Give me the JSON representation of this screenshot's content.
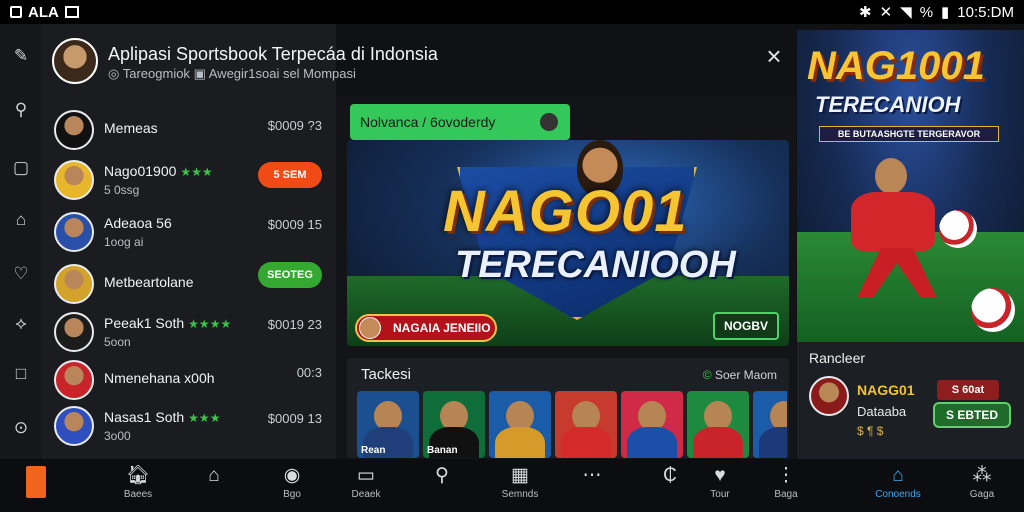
{
  "status_bar": {
    "left_text": "ALA",
    "right_percent": "%",
    "time": "10:5:DM"
  },
  "header": {
    "title": "Aplipasi Sportsbook Terpecáa di Indonsia",
    "subtitle_a": "Tareogmiok",
    "subtitle_b": "Awegir1soai sel Mompasi",
    "close_glyph": "×"
  },
  "chats": [
    {
      "name": "Memeas",
      "sub": "",
      "stars": "",
      "amount": "$0009 ?3",
      "pill": ""
    },
    {
      "name": "Nago01900",
      "sub": "5 0ssg",
      "stars": "★★★",
      "amount": "",
      "pill": "5 SEM",
      "pill_color": "orange"
    },
    {
      "name": "Adeaoa 56",
      "sub": "1oog ai",
      "stars": "",
      "amount": "$0009 15",
      "pill": ""
    },
    {
      "name": "Metbeartolane",
      "sub": "",
      "stars": "",
      "amount": "",
      "pill": "SEOTEG",
      "pill_color": "green"
    },
    {
      "name": "Peeak1 Soth",
      "sub": "5oon",
      "stars": "★★★★",
      "amount": "$0019 23",
      "pill": ""
    },
    {
      "name": "Nmenehana x00h",
      "sub": "",
      "stars": "",
      "amount": "00:3",
      "pill": ""
    },
    {
      "name": "Nasas1 Soth",
      "sub": "3o00",
      "stars": "★★★",
      "amount": "$0009 13",
      "pill": ""
    }
  ],
  "promo": {
    "label": "Nolvanca / 6ovoderdy"
  },
  "banner": {
    "headline": "NAGO01",
    "tagline": "TERECANIOOH",
    "left_button": "NAGAIA JENEIIO",
    "right_button": "NOGBV"
  },
  "tackle": {
    "title": "Tackesi",
    "link_icon": "©",
    "link_text": "Soer Maom",
    "tiles": [
      {
        "label": "Rean",
        "bg": "#1b4f8f",
        "shirt": "#1f3e7a"
      },
      {
        "label": "Banan",
        "bg": "#0f6d3a",
        "shirt": "#111"
      },
      {
        "label": "",
        "bg": "#1b5ca8",
        "shirt": "#d59a2a"
      },
      {
        "label": "",
        "bg": "#c73a2e",
        "shirt": "#d52a2a"
      },
      {
        "label": "",
        "bg": "#d12a46",
        "shirt": "#1c50a8"
      },
      {
        "label": "",
        "bg": "#1e8a40",
        "shirt": "#c8242a"
      },
      {
        "label": "",
        "bg": "#1b5ca8",
        "shirt": "#1c3a7a"
      }
    ]
  },
  "poster": {
    "title": "NAG1001",
    "subtitle": "TERECANIOH",
    "strip": "BE BUTAASHGTE TERGERAVOR"
  },
  "right_card": {
    "header": "Rancleer",
    "name": "NAGG01",
    "sub": "Dataaba",
    "stars": "$ ¶ $",
    "pill_top": "S 60at",
    "pill_bottom": "S EBTED"
  },
  "bottom_nav": [
    {
      "label": "Baees",
      "icon": "🏠︎"
    },
    {
      "label": "",
      "icon": "⌂"
    },
    {
      "label": "Bgo",
      "icon": "◉"
    },
    {
      "label": "Deaek",
      "icon": "▭"
    },
    {
      "label": "",
      "icon": "⚲"
    },
    {
      "label": "Semnds",
      "icon": "▦"
    },
    {
      "label": "",
      "icon": "⋯"
    },
    {
      "label": "",
      "icon": "₵"
    },
    {
      "label": "Tour",
      "icon": "♥"
    },
    {
      "label": "Baga",
      "icon": "⋮"
    },
    {
      "label": "Conoends",
      "icon": "⌂"
    },
    {
      "label": "Gaga",
      "icon": "⁂"
    }
  ],
  "colors": {
    "accent_blue": "#3ea7f2",
    "pill_orange": "#f04b16",
    "pill_green": "#35a832",
    "promo_green": "#34c759",
    "gold": "#f5c431"
  }
}
